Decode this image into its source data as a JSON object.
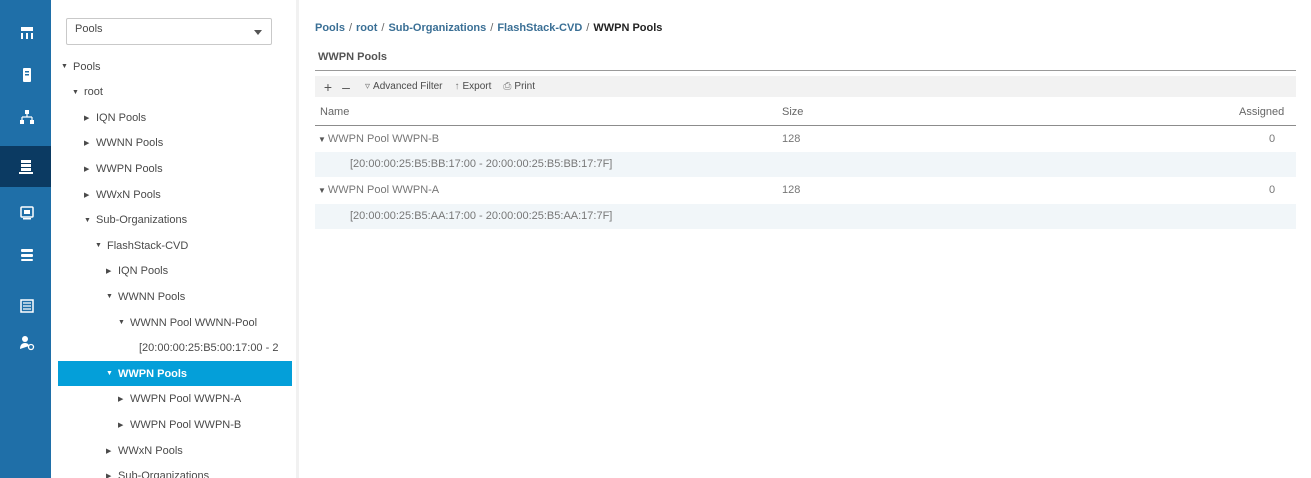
{
  "sidebar": {
    "icons": [
      "equipment-icon",
      "servers-icon",
      "lan-icon",
      "san-icon",
      "vm-icon",
      "storage-icon",
      "chassis-list-icon",
      "admin-icon"
    ],
    "active_index": 3,
    "accent": "#1f6fa8",
    "active_color": "#0b3a62"
  },
  "filter": {
    "selected": "Pools"
  },
  "tree": [
    {
      "label": "Pools",
      "toggle": "down",
      "depth": 0
    },
    {
      "label": "root",
      "toggle": "down",
      "depth": 1
    },
    {
      "label": "IQN Pools",
      "toggle": "right",
      "depth": 2
    },
    {
      "label": "WWNN Pools",
      "toggle": "right",
      "depth": 2
    },
    {
      "label": "WWPN Pools",
      "toggle": "right",
      "depth": 2
    },
    {
      "label": "WWxN Pools",
      "toggle": "right",
      "depth": 2
    },
    {
      "label": "Sub-Organizations",
      "toggle": "down",
      "depth": 2
    },
    {
      "label": "FlashStack-CVD",
      "toggle": "down",
      "depth": 3
    },
    {
      "label": "IQN Pools",
      "toggle": "right",
      "depth": 4
    },
    {
      "label": "WWNN Pools",
      "toggle": "down",
      "depth": 4
    },
    {
      "label": "WWNN Pool WWNN-Pool",
      "toggle": "down",
      "depth": 5
    },
    {
      "label": "[20:00:00:25:B5:00:17:00 - 2",
      "toggle": "",
      "depth": 6
    },
    {
      "label": "WWPN Pools",
      "toggle": "down",
      "depth": 4,
      "selected": true
    },
    {
      "label": "WWPN Pool WWPN-A",
      "toggle": "right",
      "depth": 5
    },
    {
      "label": "WWPN Pool WWPN-B",
      "toggle": "right",
      "depth": 5
    },
    {
      "label": "WWxN Pools",
      "toggle": "right",
      "depth": 4
    },
    {
      "label": "Sub-Organizations",
      "toggle": "right",
      "depth": 4
    }
  ],
  "breadcrumb": {
    "items": [
      "Pools",
      "root",
      "Sub-Organizations",
      "FlashStack-CVD"
    ],
    "current": "WWPN Pools",
    "separator": "/"
  },
  "section": {
    "title": "WWPN Pools"
  },
  "toolbar": {
    "add": "+",
    "remove": "–",
    "advanced_filter": "Advanced Filter",
    "export": "Export",
    "print": "Print"
  },
  "table": {
    "columns": [
      "Name",
      "Size",
      "Assigned"
    ],
    "rows": [
      {
        "name": "WWPN Pool WWPN-B",
        "size": "128",
        "assigned": "0",
        "block": "[20:00:00:25:B5:BB:17:00 - 20:00:00:25:B5:BB:17:7F]"
      },
      {
        "name": "WWPN Pool WWPN-A",
        "size": "128",
        "assigned": "0",
        "block": "[20:00:00:25:B5:AA:17:00 - 20:00:00:25:B5:AA:17:7F]"
      }
    ]
  },
  "colors": {
    "selected_row": "#049fd9",
    "breadcrumb_link": "#3a6f95",
    "sub_row_bg": "#f1f6f9"
  }
}
